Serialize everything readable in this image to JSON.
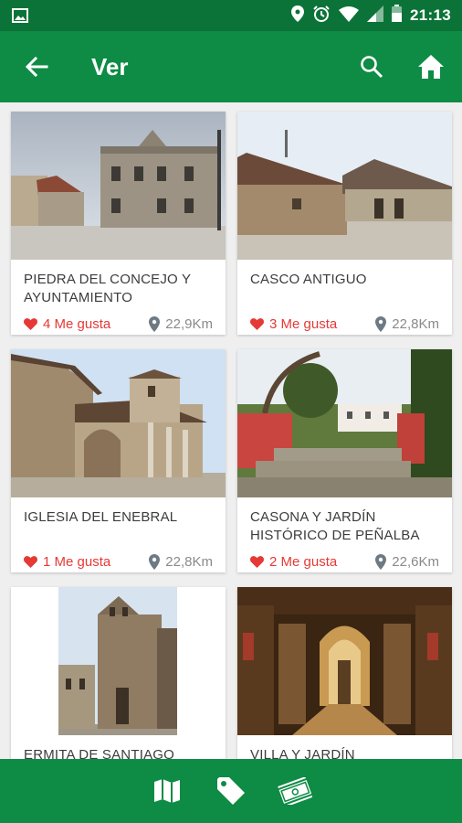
{
  "status": {
    "time": "21:13"
  },
  "header": {
    "title": "Ver"
  },
  "places": [
    {
      "name": "PIEDRA DEL CONCEJO Y AYUNTAMIENTO",
      "likes": "4 Me gusta",
      "distance": "22,9Km"
    },
    {
      "name": "CASCO ANTIGUO",
      "likes": "3 Me gusta",
      "distance": "22,8Km"
    },
    {
      "name": "IGLESIA DEL ENEBRAL",
      "likes": "1 Me gusta",
      "distance": "22,8Km"
    },
    {
      "name": "CASONA Y JARDÍN HISTÓRICO DE PEÑALBA",
      "likes": "2 Me gusta",
      "distance": "22,6Km"
    },
    {
      "name": "ERMITA DE SANTIAGO",
      "likes": "",
      "distance": ""
    },
    {
      "name": "VILLA Y JARDÍN",
      "likes": "",
      "distance": ""
    }
  ],
  "bottom_nav": [
    "map-icon",
    "tag-icon",
    "money-icon"
  ],
  "colors": {
    "primary": "#0e8b44",
    "status_bar": "#0b7337",
    "like": "#e53935",
    "distance": "#8a8a8a"
  }
}
